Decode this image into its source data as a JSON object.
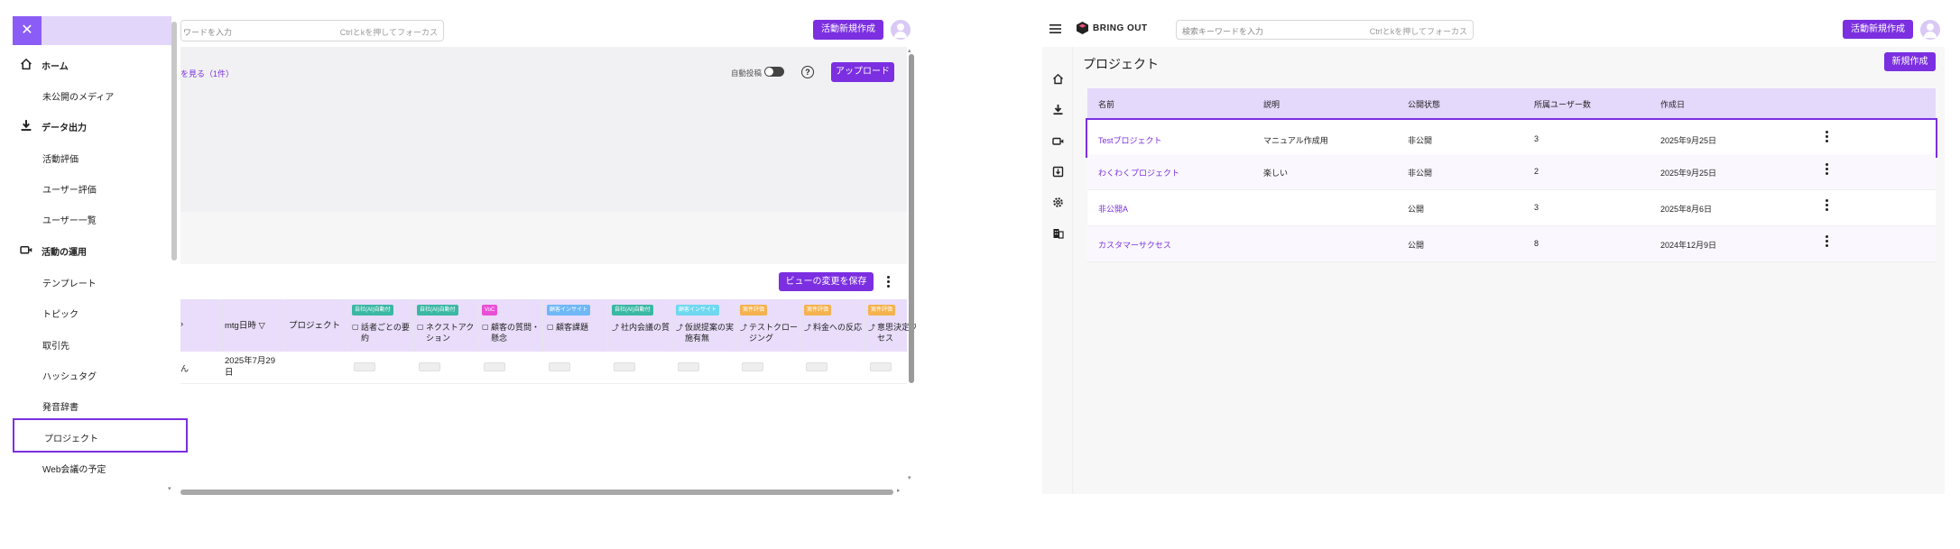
{
  "left": {
    "search": {
      "placeholder": "ワードを入力",
      "hint": "Ctrlとkを押してフォーカス"
    },
    "new_activity": "活動新規作成",
    "view_more": "を見る（1件）",
    "auto_post": "自動投稿",
    "help": "?",
    "upload": "アップロード",
    "save_view": "ビューの変更を保存",
    "sidebar": {
      "close": "✕",
      "items": [
        {
          "label": "ホーム",
          "icon": "home-icon",
          "section": true
        },
        {
          "label": "未公開のメディア"
        },
        {
          "label": "データ出力",
          "icon": "download-icon",
          "section": true
        },
        {
          "label": "活動評価"
        },
        {
          "label": "ユーザー評価"
        },
        {
          "label": "ユーザー一覧"
        },
        {
          "label": "活動の運用",
          "icon": "video-icon",
          "section": true
        },
        {
          "label": "テンプレート"
        },
        {
          "label": "トピック"
        },
        {
          "label": "取引先"
        },
        {
          "label": "ハッシュタグ"
        },
        {
          "label": "発音辞書"
        },
        {
          "label": "プロジェクト",
          "active": true
        },
        {
          "label": "Web会議の予定"
        }
      ]
    },
    "table": {
      "columns": [
        {
          "label": "mtg日時 ▽"
        },
        {
          "label": "プロジェクト"
        },
        {
          "tag": "自社(AI)自動付",
          "tag_color": "#3bb8a4",
          "icon": "doc-icon",
          "label": "話者ごとの要約"
        },
        {
          "tag": "自社(AI)自動付",
          "tag_color": "#3bb8a4",
          "icon": "doc-icon",
          "label": "ネクストアクション"
        },
        {
          "tag": "VoC",
          "tag_color": "#e94fd6",
          "icon": "doc-icon",
          "label": "顧客の質問・懸念"
        },
        {
          "tag": "顧客インサイト",
          "tag_color": "#6fb8f5",
          "icon": "doc-icon",
          "label": "顧客課題"
        },
        {
          "tag": "自社(AI)自動付",
          "tag_color": "#3bb8a4",
          "icon": "trend-icon",
          "label": "社内会議の質"
        },
        {
          "tag": "顧客インサイト",
          "tag_color": "#6fd8f0",
          "icon": "trend-icon",
          "label": "仮説提案の実施有無"
        },
        {
          "tag": "案件評価",
          "tag_color": "#f5b24f",
          "icon": "trend-icon",
          "label": "テストクロージング"
        },
        {
          "tag": "案件評価",
          "tag_color": "#f5b24f",
          "icon": "trend-icon",
          "label": "料金への反応"
        },
        {
          "tag": "案件評価",
          "tag_color": "#f5b24f",
          "icon": "trend-icon",
          "label": "意思決定プロセス"
        }
      ],
      "row": {
        "prefix": "ん",
        "date": "2025年7月29日"
      }
    }
  },
  "right": {
    "brand": "BRING OUT",
    "search": {
      "placeholder": "検索キーワードを入力",
      "hint": "Ctrlとkを押してフォーカス"
    },
    "new_activity": "活動新規作成",
    "page_title": "プロジェクト",
    "new_button": "新規作成",
    "table": {
      "headers": [
        "名前",
        "説明",
        "公開状態",
        "所属ユーザー数",
        "作成日"
      ],
      "rows": [
        {
          "name": "Testプロジェクト",
          "desc": "マニュアル作成用",
          "status": "非公開",
          "users": "3",
          "created": "2025年9月25日",
          "selected": true
        },
        {
          "name": "わくわくプロジェクト",
          "desc": "楽しい",
          "status": "非公開",
          "users": "2",
          "created": "2025年9月25日"
        },
        {
          "name": "非公開A",
          "desc": "",
          "status": "公開",
          "users": "3",
          "created": "2025年8月6日"
        },
        {
          "name": "カスタマーサクセス",
          "desc": "",
          "status": "公開",
          "users": "8",
          "created": "2024年12月9日"
        }
      ]
    }
  },
  "colors": {
    "accent": "#7b2fe0",
    "header_bg": "#e4d8fb"
  }
}
